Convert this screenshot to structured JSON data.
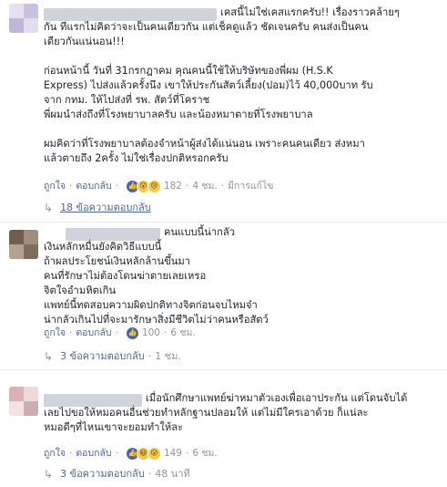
{
  "comments": [
    {
      "name_tail": "เคสนี้ไม่ใช่เคสแรกครับ!! เรื่องราวคล้ายๆ",
      "text": "กัน ทีแรกไม่คิดว่าจะเป็นคนเดียวกัน แต่เช็คดูแล้ว ชัดเจนครับ คนส่งเป็นคน\nเดียวกันแน่นอน!!!\n\nก่อนหน้านี้ วันที่ 31กรกฎาคม คุณคนนี้ใช้ให้บริษัทของพี่ผม (H.S.K\nExpress) ไปส่งแล้วครั้งนึง เขาให้ประกันสัตว์เลี้ยง(ปอม)ไว้ 40,000บาท รับ\nจาก กทม. ให้ไปส่งที่ รพ. สัตว์ที่โคราช\nพี่ผมนำส่งถึงที่โรงพยาบาลครับ และน้องหมาตายที่โรงพยาบาล\n\nผมคิดว่าที่โรงพยาบาลต้องจำหน้าผู้ส่งได้แน่นอน เพราะคนคนเดียว ส่งหมา\nแล้วตายถึง 2ครั้ง ไม่ใช่เรื่องปกติหรอกครับ",
      "like_label": "ถูกใจ",
      "reply_label": "ตอบกลับ",
      "reaction_count": "182",
      "time": "4 ชม.",
      "edited": "มีการแก้ไข",
      "replies_label": "18 ข้อความตอบกลับ"
    },
    {
      "name_tail": "คนแบบนี้น่ากลัว",
      "text": "เงินหลักหมื่นยังคิดวิธีแบบนี้\nถ้าผลประโยชน์เงินหลักล้านขึ้นมา\nคนที่รักษาไม่ต้องโดนฆ่าตายเลยเหรอ\nจิตใจอำมหิตเกิน\nแพทย์นี้ทดสอบความผิดปกติทางจิตก่อนจบไหมจ๋า\nน่ากลัวเกินไปที่จะมารักษาสิ่งมีชีวิตไม่ว่าคนหรือสัตว์",
      "like_label": "ถูกใจ",
      "reply_label": "ตอบกลับ",
      "reaction_count": "100",
      "time": "6 ชม.",
      "replies_label": "3 ข้อความตอบกลับ",
      "replies_time": "1 ชม."
    },
    {
      "name_tail": "เมื่อนักศึกษาแพทย์ฆ่าหมาตัวเองเพื่อเอาประกัน แต่โดนจับได้",
      "text": "เลยไปขอให้หมอคนอื่นช่วยทำหลักฐานปลอมให้ แต่ไม่มีใครเอาด้วย ก็แน่ละ\nหมอดีๆที่ไหนเขาจะยอมทำให้ละ",
      "like_label": "ถูกใจ",
      "reply_label": "ตอบกลับ",
      "reaction_count": "149",
      "time": "6 ชม.",
      "replies_label": "3 ข้อความตอบกลับ",
      "replies_time": "48 นาที"
    }
  ],
  "colors": {
    "link": "#4b67a1",
    "meta": "#90949c",
    "like": "#4267b2"
  }
}
